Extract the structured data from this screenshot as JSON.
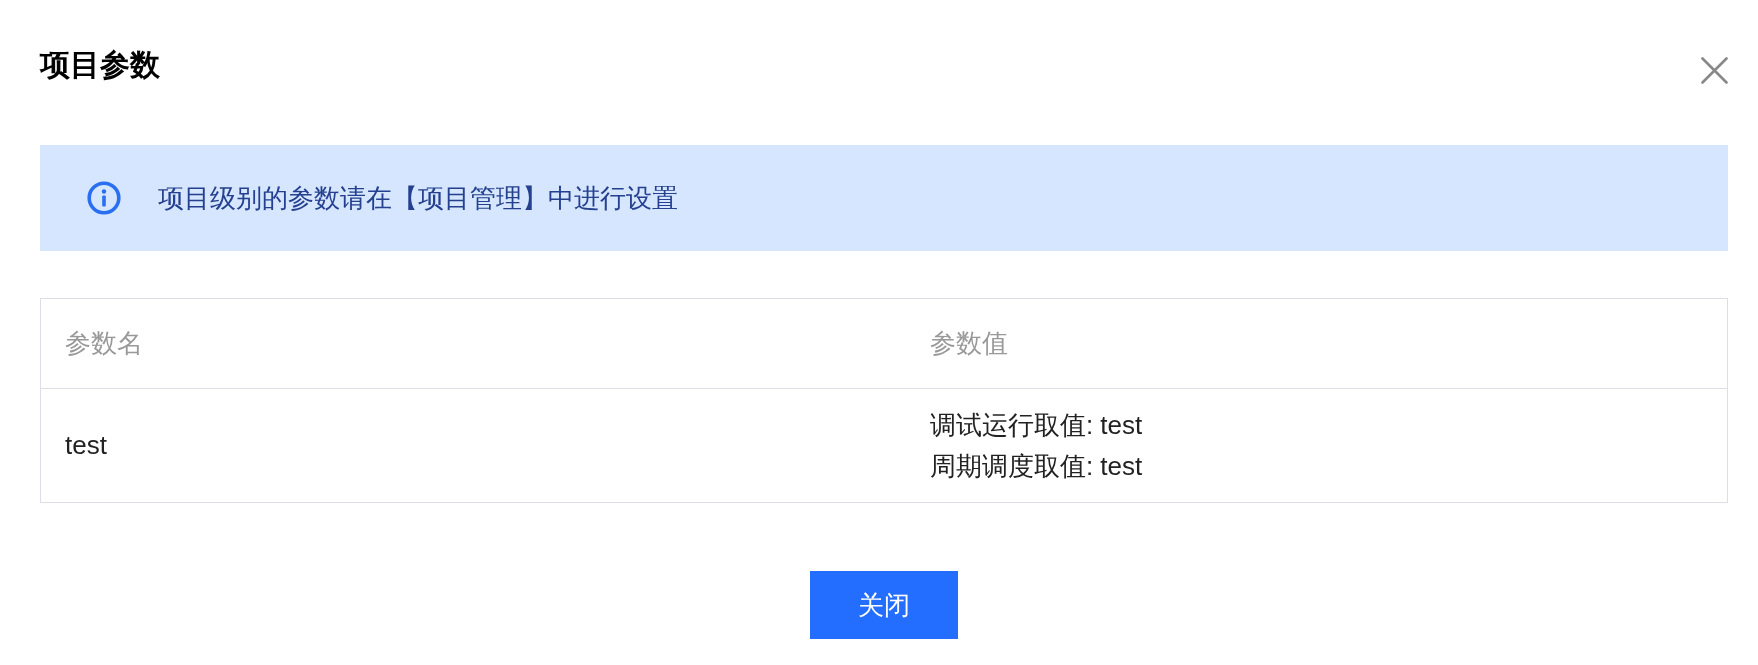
{
  "dialog": {
    "title": "项目参数"
  },
  "notice": {
    "text": "项目级别的参数请在【项目管理】中进行设置"
  },
  "table": {
    "columns": [
      "参数名",
      "参数值"
    ],
    "rows": [
      {
        "name": "test",
        "values": [
          "调试运行取值: test",
          "周期调度取值: test"
        ]
      }
    ]
  },
  "footer": {
    "button": "关闭"
  }
}
